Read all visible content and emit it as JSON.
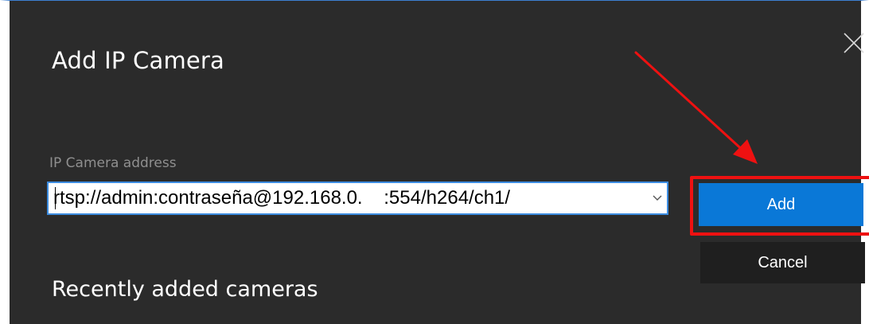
{
  "dialog": {
    "title": "Add IP Camera",
    "close_icon": "close-icon"
  },
  "address": {
    "label": "IP Camera address",
    "value": "rtsp://admin:contraseña@192.168.0.    :554/h264/ch1/",
    "dropdown_icon": "chevron-down-icon"
  },
  "buttons": {
    "add_label": "Add",
    "cancel_label": "Cancel"
  },
  "recent": {
    "title": "Recently added cameras"
  },
  "colors": {
    "background": "#2b2b2b",
    "accent": "#0a78d7",
    "annotation": "#ee1111"
  }
}
